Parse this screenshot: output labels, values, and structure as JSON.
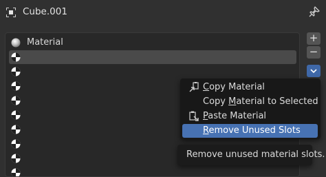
{
  "header": {
    "title": "Cube.001",
    "object_icon": "object-data-icon",
    "pin_icon": "pin-icon"
  },
  "slots": {
    "items": [
      {
        "label": "Material",
        "icon": "material-sphere-icon"
      },
      {
        "label": "",
        "icon": "empty-material-icon",
        "selected": true
      },
      {
        "label": "",
        "icon": "empty-material-icon"
      },
      {
        "label": "",
        "icon": "empty-material-icon"
      },
      {
        "label": "",
        "icon": "empty-material-icon"
      },
      {
        "label": "",
        "icon": "empty-material-icon"
      },
      {
        "label": "",
        "icon": "empty-material-icon"
      },
      {
        "label": "",
        "icon": "empty-material-icon"
      },
      {
        "label": "",
        "icon": "empty-material-icon"
      },
      {
        "label": "",
        "icon": "empty-material-icon"
      }
    ]
  },
  "side_buttons": {
    "add": "+",
    "remove": "−",
    "specials": "⌄"
  },
  "menu": {
    "items": [
      {
        "pre": "",
        "key": "C",
        "post": "opy Material",
        "icon": "copy-material-icon"
      },
      {
        "pre": "Copy ",
        "key": "M",
        "post": "aterial to Selected",
        "icon": ""
      },
      {
        "pre": "",
        "key": "P",
        "post": "aste Material",
        "icon": "paste-material-icon"
      },
      {
        "pre": "",
        "key": "R",
        "post": "emove Unused Slots",
        "icon": "",
        "highlighted": true
      }
    ]
  },
  "tooltip": {
    "text": "Remove unused material slots."
  },
  "colors": {
    "highlight": "#4772b3",
    "background": "#303030",
    "list_bg": "#282828"
  }
}
